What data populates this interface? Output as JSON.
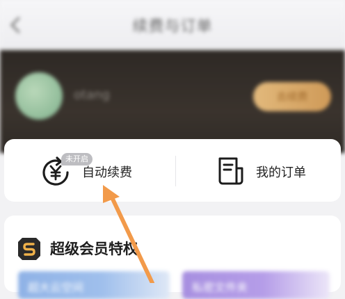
{
  "topbar": {
    "title": "续费与订单"
  },
  "header": {
    "username": "otang",
    "vip_button": "去续费"
  },
  "quick_actions": {
    "auto_renew": {
      "badge": "未开启",
      "label": "自动续费"
    },
    "my_orders": {
      "label": "我的订单"
    }
  },
  "privileges": {
    "title": "超级会员特权",
    "tiles": [
      {
        "label": "超大云空间"
      },
      {
        "label": "私密文件夹"
      }
    ]
  },
  "colors": {
    "header_bg": "#2e2925",
    "vip_gold": "#d9a866",
    "annotation_arrow": "#f29a4a"
  }
}
